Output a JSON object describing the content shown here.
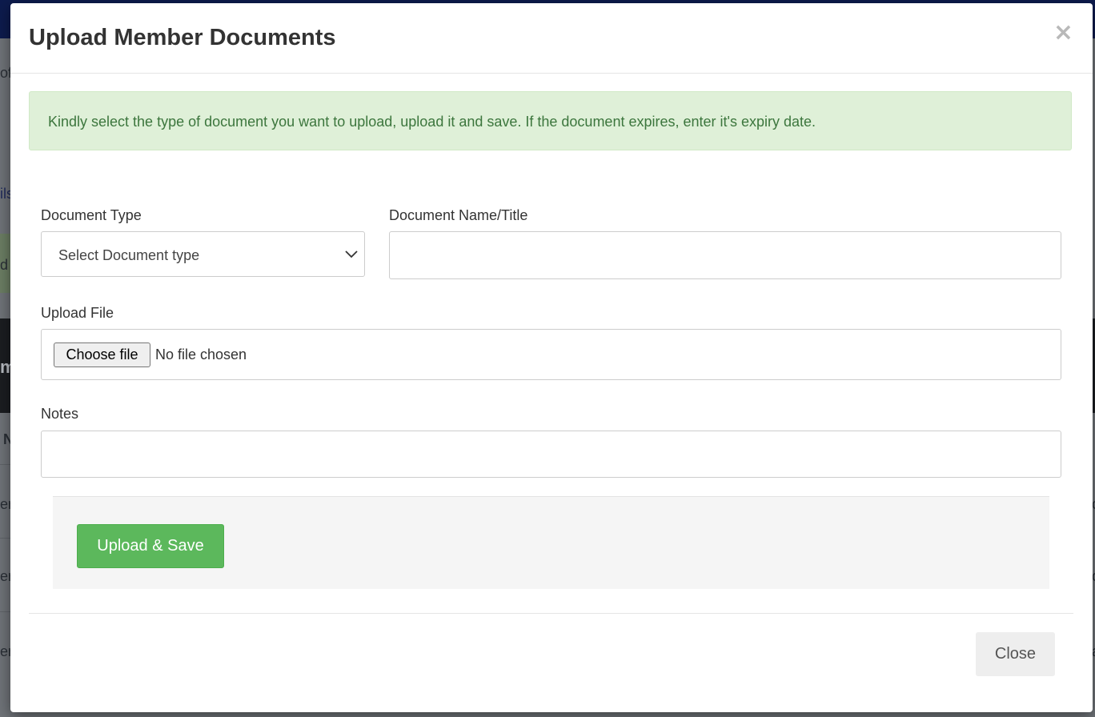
{
  "background": {
    "fragments": [
      "of",
      "ils",
      "d",
      "m",
      "N",
      "er",
      "er",
      "er",
      "c",
      "c",
      "a"
    ]
  },
  "modal": {
    "title": "Upload Member Documents",
    "close_symbol": "×",
    "alert_text": "Kindly select the type of document you want to upload, upload it and save. If the document expires, enter it's expiry date.",
    "fields": {
      "document_type": {
        "label": "Document Type",
        "selected": "Select Document type"
      },
      "document_name": {
        "label": "Document Name/Title",
        "value": ""
      },
      "upload_file": {
        "label": "Upload File",
        "button": "Choose file",
        "status": "No file chosen"
      },
      "notes": {
        "label": "Notes",
        "value": ""
      }
    },
    "upload_button": "Upload & Save",
    "close_button": "Close"
  },
  "colors": {
    "alert_bg": "#dff0d8",
    "alert_text": "#3c763d",
    "success": "#5cb85c",
    "backdrop": "#6f7378",
    "topbar": "#0d1b4d"
  }
}
